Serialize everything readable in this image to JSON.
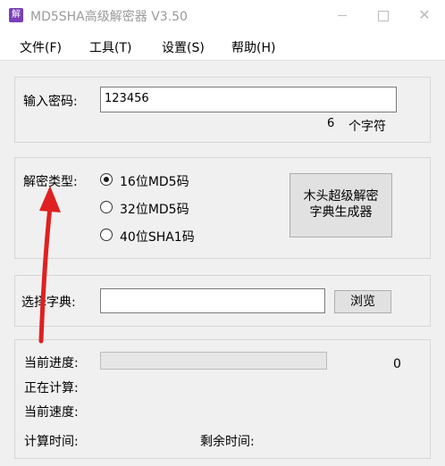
{
  "window": {
    "title": "MD5SHA高级解密器 V3.50",
    "app_icon": "app-logo-icon",
    "controls": [
      "minimize-icon",
      "maximize-icon",
      "close-icon"
    ]
  },
  "menu": {
    "file": "文件(F)",
    "tools": "工具(T)",
    "settings": "设置(S)",
    "help": "帮助(H)"
  },
  "password": {
    "label": "输入密码:",
    "value": "123456",
    "char_count": "6",
    "char_suffix": "个字符"
  },
  "decrypt_type": {
    "label": "解密类型:",
    "options": [
      "16位MD5码",
      "32位MD5码",
      "40位SHA1码"
    ],
    "selected_index": 0,
    "generator_button_line1": "木头超级解密",
    "generator_button_line2": "字典生成器"
  },
  "dictionary": {
    "label": "选择字典:",
    "value": "",
    "browse_label": "浏览"
  },
  "status": {
    "progress_label": "当前进度:",
    "progress_value": "0",
    "progress_fraction": 0,
    "computing_label": "正在计算:",
    "speed_label": "当前速度:",
    "elapsed_label": "计算时间:",
    "remaining_label": "剩余时间:"
  },
  "annotation": {
    "arrow_color": "#e02020",
    "arrow_icon": "red-arrow-icon"
  }
}
